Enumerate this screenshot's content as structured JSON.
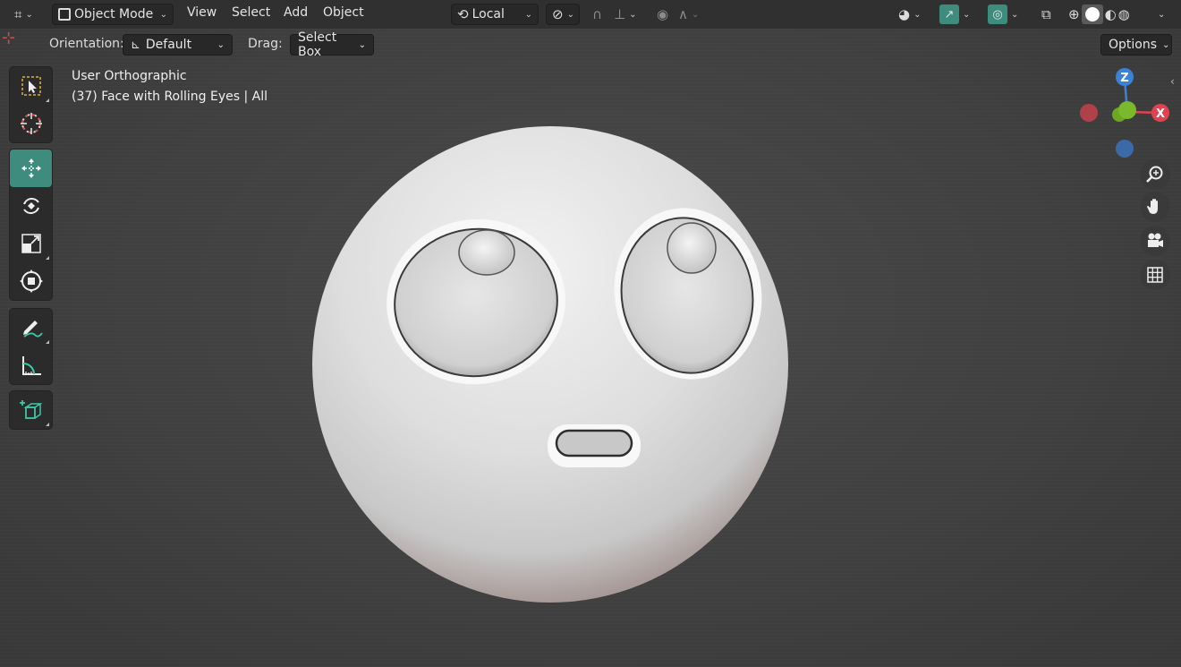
{
  "header": {
    "mode_label": "Object Mode",
    "menus": [
      "View",
      "Select",
      "Add",
      "Object"
    ],
    "transform_orientation": "Local",
    "options_label": "Options"
  },
  "tool_settings": {
    "orientation_label": "Orientation:",
    "orientation_value": "Default",
    "drag_label": "Drag:",
    "drag_value": "Select Box"
  },
  "viewport": {
    "view_name": "User Orthographic",
    "object_info": "(37) Face with Rolling Eyes | All"
  },
  "gizmo": {
    "z_label": "Z",
    "x_label": "X"
  },
  "toolbar": {
    "tools": [
      "select-box",
      "cursor",
      "move",
      "rotate",
      "scale",
      "transform",
      "annotate",
      "measure",
      "add-cube"
    ],
    "active_tool": "move"
  },
  "colors": {
    "accent": "#3d8c7e",
    "axis_x": "#e0424f",
    "axis_y": "#6ea624",
    "axis_z": "#3b82d6"
  }
}
